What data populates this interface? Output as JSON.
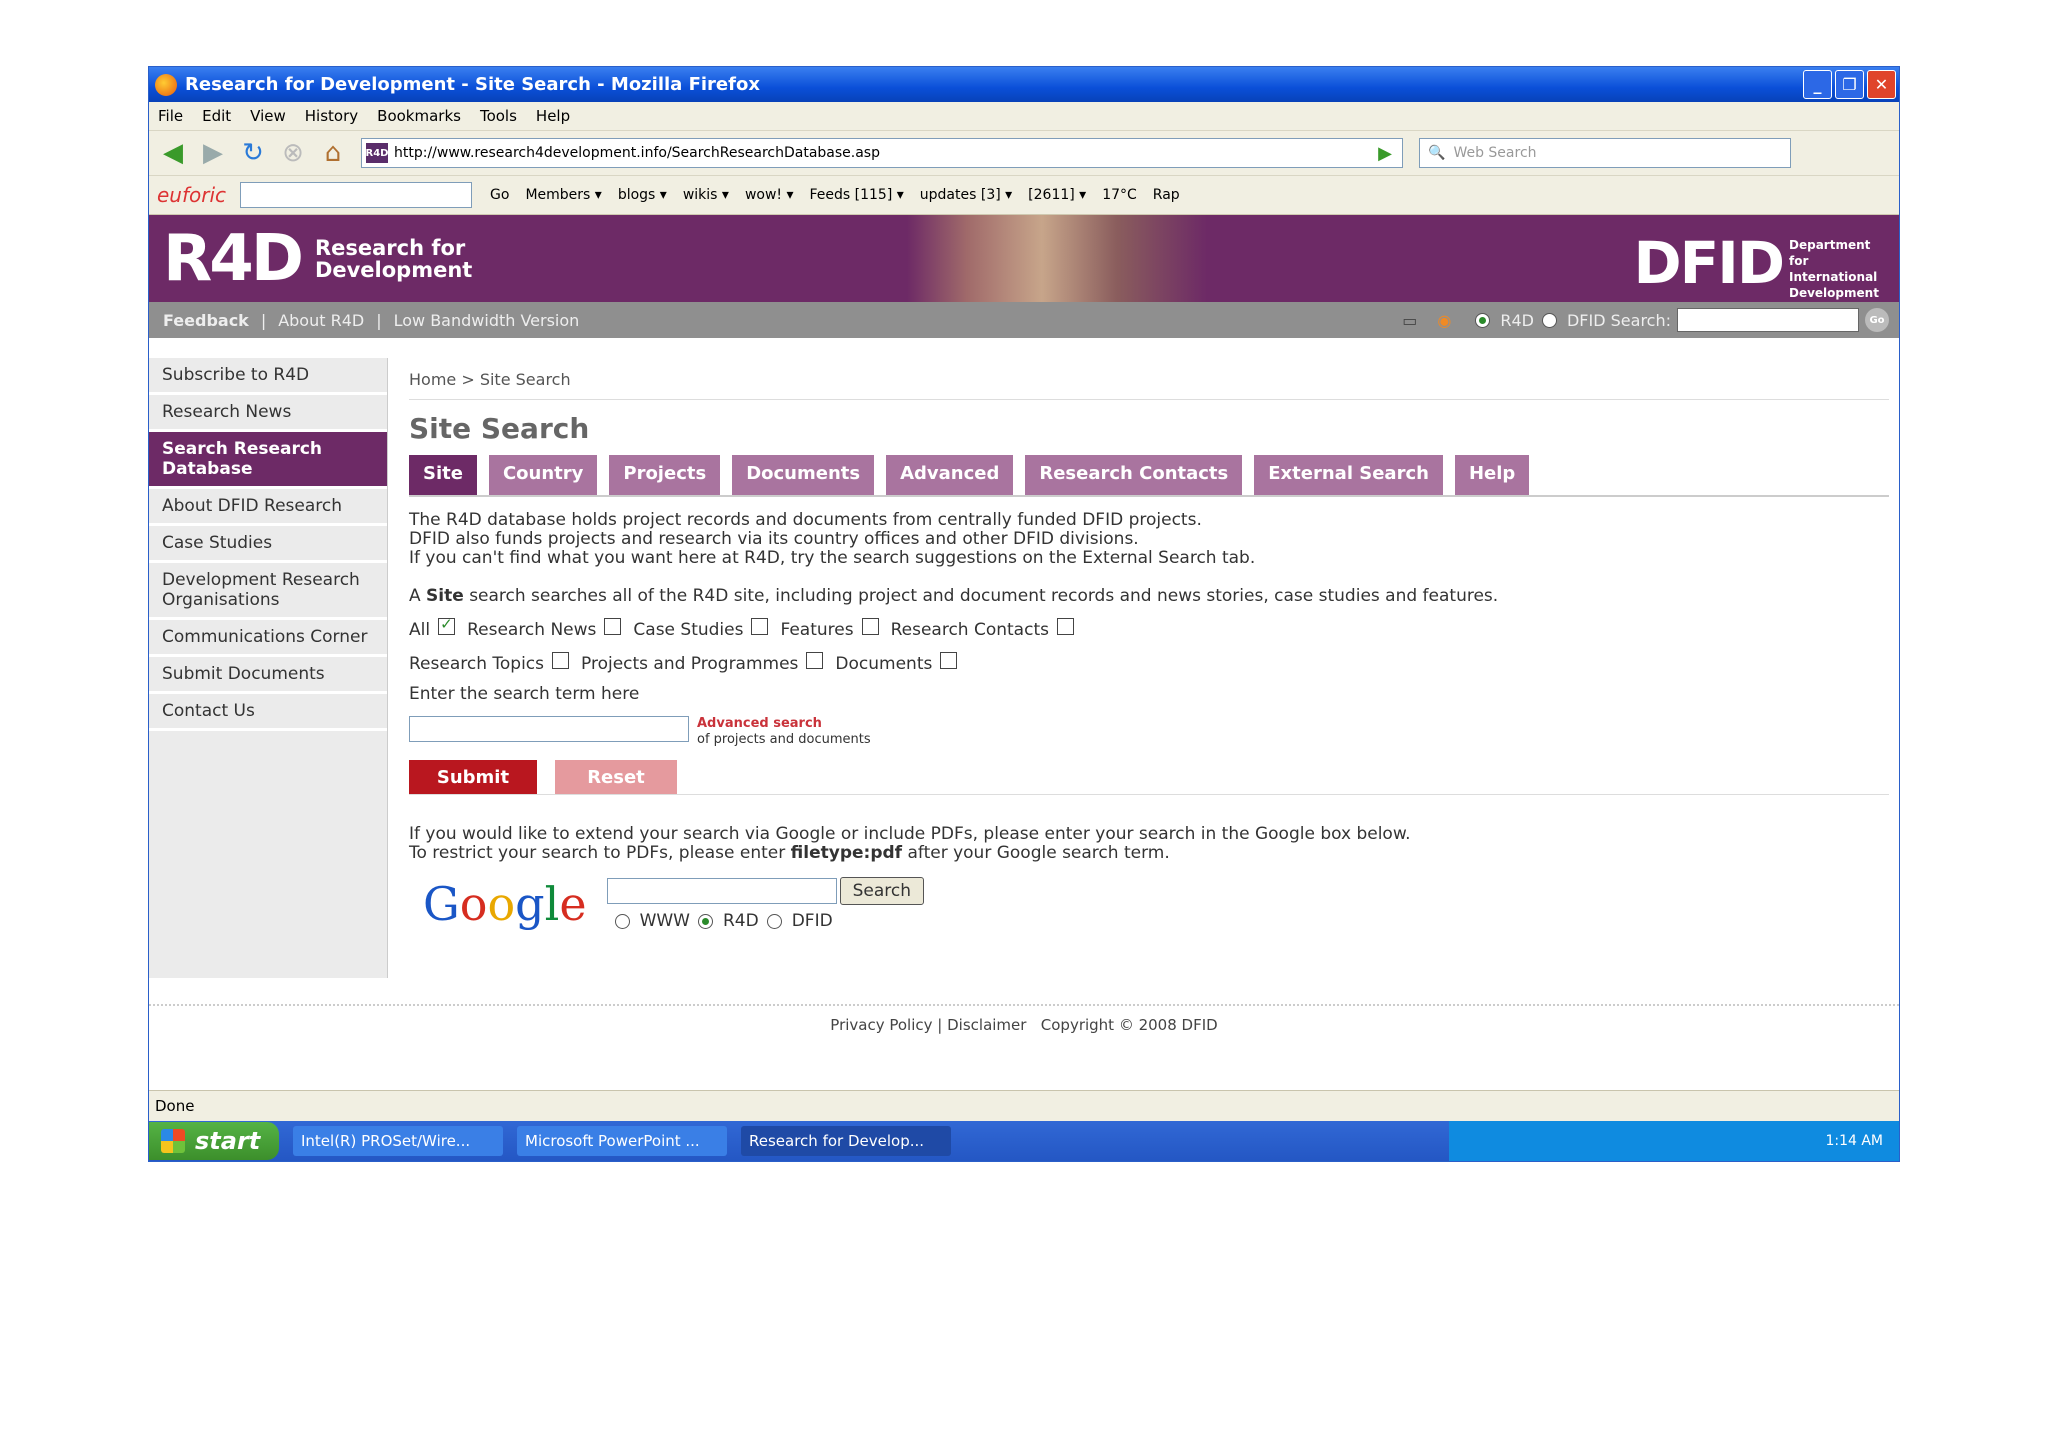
{
  "window": {
    "title": "Research for Development - Site Search - Mozilla Firefox"
  },
  "menu": [
    "File",
    "Edit",
    "View",
    "History",
    "Bookmarks",
    "Tools",
    "Help"
  ],
  "address": {
    "url": "http://www.research4development.info/SearchResearchDatabase.asp",
    "websearch_placeholder": "Web Search"
  },
  "toolbar2": {
    "brand": "euforic",
    "go": "Go",
    "members": "Members ▾",
    "blogs": "blogs ▾",
    "wikis": "wikis ▾",
    "wow": "wow! ▾",
    "feeds": "Feeds [115] ▾",
    "updates": "updates [3] ▾",
    "mail": "[2611] ▾",
    "temp": "17°C",
    "radio": "Rap"
  },
  "banner": {
    "logo": "R4D",
    "logo_sub": "Research for Development",
    "dfid": "DFID",
    "dfid_sub": "Department for International Development"
  },
  "subnav": {
    "feedback": "Feedback",
    "about": "About R4D",
    "low": "Low Bandwidth Version",
    "opt1": "R4D",
    "opt2": "DFID Search:",
    "go": "Go"
  },
  "sidebar": [
    "Subscribe to R4D",
    "Research News",
    "Search Research Database",
    "About DFID Research",
    "Case Studies",
    "Development Research Organisations",
    "Communications Corner",
    "Submit Documents",
    "Contact Us"
  ],
  "crumb": "Home > Site Search",
  "heading": "Site Search",
  "tabs": [
    "Site",
    "Country",
    "Projects",
    "Documents",
    "Advanced",
    "Research Contacts",
    "External Search",
    "Help"
  ],
  "intro": {
    "l1": "The R4D database holds project records and documents from centrally funded DFID projects.",
    "l2": "DFID also funds projects and research via its country offices and other DFID divisions.",
    "l3": "If you can't find what you want here at R4D, try the search suggestions on the External Search tab."
  },
  "site_text": {
    "a": "A",
    "b": "Site",
    "c": "search searches all of the R4D site, including project and document records and news stories, case studies and features."
  },
  "checks": {
    "all": "All",
    "news": "Research News",
    "cases": "Case Studies",
    "features": "Features",
    "contacts": "Research Contacts",
    "topics": "Research Topics",
    "projects": "Projects and Programmes",
    "documents": "Documents"
  },
  "term_label": "Enter the search term here",
  "advanced": {
    "link": "Advanced search",
    "sub": "of projects and documents"
  },
  "buttons": {
    "submit": "Submit",
    "reset": "Reset"
  },
  "google_note": {
    "l1": "If you would like to extend your search via Google or include PDFs, please enter your search in the Google box below.",
    "l2a": "To restrict your search to PDFs, please enter",
    "l2b": "filetype:pdf",
    "l2c": "after your Google search term."
  },
  "google": {
    "search": "Search",
    "opt1": "WWW",
    "opt2": "R4D",
    "opt3": "DFID"
  },
  "footer": {
    "privacy": "Privacy Policy",
    "disclaimer": "Disclaimer",
    "copyright": "Copyright © 2008 DFID"
  },
  "status": "Done",
  "taskbar": {
    "start": "start",
    "t1": "Intel(R) PROSet/Wire...",
    "t2": "Microsoft PowerPoint ...",
    "t3": "Research for Develop...",
    "clock": "1:14 AM"
  }
}
